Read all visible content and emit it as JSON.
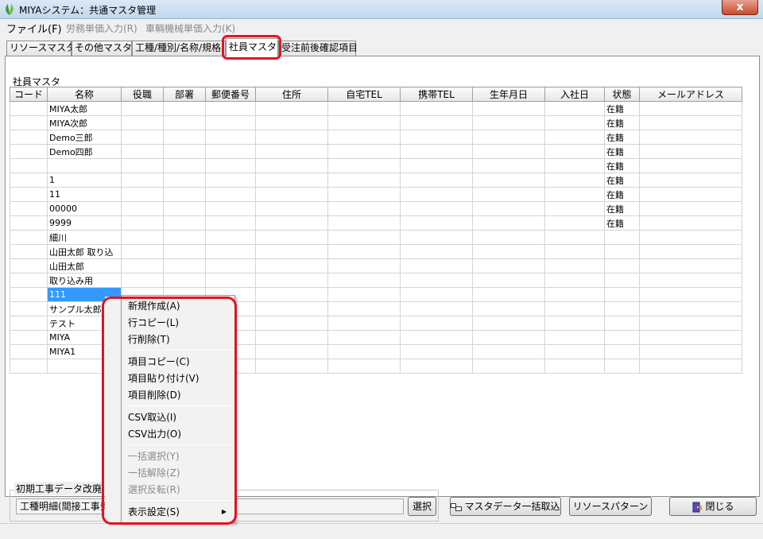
{
  "window": {
    "title": "MIYAシステム：共通マスタ管理",
    "close_label": "x"
  },
  "menu": [
    {
      "label": "ファイル(F)",
      "enabled": true
    },
    {
      "label": "労務単価入力(R)",
      "enabled": false
    },
    {
      "label": "車輌機械単価入力(K)",
      "enabled": false
    }
  ],
  "tabs": [
    {
      "label": "リソースマスタ"
    },
    {
      "label": "その他マスタ"
    },
    {
      "label": "工種/種別/名称/規格"
    },
    {
      "label": "社員マスタ",
      "active": true
    },
    {
      "label": "受注前後確認項目"
    }
  ],
  "section_label": "社員マスタ",
  "grid": {
    "columns": [
      "コード",
      "名称",
      "役職",
      "部署",
      "郵便番号",
      "住所",
      "自宅TEL",
      "携帯TEL",
      "生年月日",
      "入社日",
      "状態",
      "メールアドレス"
    ],
    "rows": [
      [
        "",
        "MIYA太郎",
        "",
        "",
        "",
        "",
        "",
        "",
        "",
        "",
        "在籍",
        ""
      ],
      [
        "",
        "MIYA次郎",
        "",
        "",
        "",
        "",
        "",
        "",
        "",
        "",
        "在籍",
        ""
      ],
      [
        "",
        "Demo三郎",
        "",
        "",
        "",
        "",
        "",
        "",
        "",
        "",
        "在籍",
        ""
      ],
      [
        "",
        "Demo四郎",
        "",
        "",
        "",
        "",
        "",
        "",
        "",
        "",
        "在籍",
        ""
      ],
      [
        "",
        "",
        "",
        "",
        "",
        "",
        "",
        "",
        "",
        "",
        "在籍",
        ""
      ],
      [
        "",
        "1",
        "",
        "",
        "",
        "",
        "",
        "",
        "",
        "",
        "在籍",
        ""
      ],
      [
        "",
        "11",
        "",
        "",
        "",
        "",
        "",
        "",
        "",
        "",
        "在籍",
        ""
      ],
      [
        "",
        "00000",
        "",
        "",
        "",
        "",
        "",
        "",
        "",
        "",
        "在籍",
        ""
      ],
      [
        "",
        "9999",
        "",
        "",
        "",
        "",
        "",
        "",
        "",
        "",
        "在籍",
        ""
      ],
      [
        "",
        "細川",
        "",
        "",
        "",
        "",
        "",
        "",
        "",
        "",
        "",
        ""
      ],
      [
        "",
        "山田太郎 取り込",
        "",
        "",
        "",
        "",
        "",
        "",
        "",
        "",
        "",
        ""
      ],
      [
        "",
        "山田太郎",
        "",
        "",
        "",
        "",
        "",
        "",
        "",
        "",
        "",
        ""
      ],
      [
        "",
        "取り込み用",
        "",
        "",
        "",
        "",
        "",
        "",
        "",
        "",
        "",
        ""
      ],
      [
        "",
        "111",
        "",
        "",
        "",
        "",
        "",
        "",
        "",
        "",
        "",
        ""
      ],
      [
        "",
        "サンプル太郎",
        "",
        "",
        "",
        "",
        "",
        "",
        "",
        "",
        "",
        ""
      ],
      [
        "",
        "テスト",
        "",
        "",
        "",
        "",
        "",
        "",
        "",
        "",
        "",
        ""
      ],
      [
        "",
        "MIYA",
        "",
        "",
        "",
        "",
        "",
        "",
        "",
        "",
        "",
        ""
      ],
      [
        "",
        "MIYA1",
        "",
        "",
        "",
        "",
        "",
        "",
        "",
        "",
        "",
        ""
      ],
      [
        "",
        "",
        "",
        "",
        "",
        "",
        "",
        "",
        "",
        "",
        "",
        ""
      ]
    ],
    "selected_row": 13,
    "selected_col": 1
  },
  "context_menu": {
    "items": [
      {
        "label": "新規作成(A)",
        "enabled": true
      },
      {
        "label": "行コピー(L)",
        "enabled": true
      },
      {
        "label": "行削除(T)",
        "enabled": true
      },
      {
        "separator": true
      },
      {
        "label": "項目コピー(C)",
        "enabled": true
      },
      {
        "label": "項目貼り付け(V)",
        "enabled": true
      },
      {
        "label": "項目削除(D)",
        "enabled": true
      },
      {
        "separator": true
      },
      {
        "label": "CSV取込(I)",
        "enabled": true
      },
      {
        "label": "CSV出力(O)",
        "enabled": true
      },
      {
        "separator": true
      },
      {
        "label": "一括選択(Y)",
        "enabled": false
      },
      {
        "label": "一括解除(Z)",
        "enabled": false
      },
      {
        "label": "選択反転(R)",
        "enabled": false
      },
      {
        "separator": true
      },
      {
        "label": "表示設定(S)",
        "enabled": true,
        "submenu": true
      }
    ]
  },
  "bottom": {
    "group_label": "初期工事データ改廃",
    "combo_value": "工種明細(間接工事費",
    "select_button": "選択",
    "bulk_import_button": "マスタデータ一括取込",
    "resource_pattern_button": "リソースパターン",
    "close_button": "閉じる"
  },
  "colors": {
    "highlight_ring": "#e0151f",
    "selection": "#3399ff"
  }
}
